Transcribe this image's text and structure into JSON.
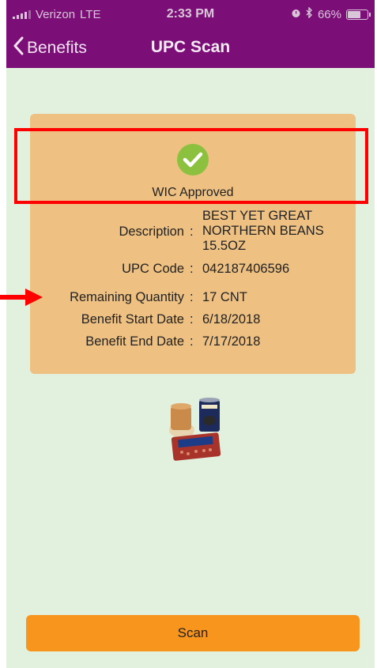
{
  "status_bar": {
    "carrier": "Verizon",
    "network": "LTE",
    "time": "2:33 PM",
    "battery": "66%"
  },
  "nav": {
    "back_label": "Benefits",
    "title": "UPC Scan"
  },
  "result": {
    "status": "WIC Approved",
    "fields": [
      {
        "label": "Description",
        "value": "BEST YET GREAT NORTHERN BEANS 15.5OZ"
      },
      {
        "label": "UPC Code",
        "value": "042187406596"
      },
      {
        "label": "Remaining Quantity",
        "value": "17 CNT"
      },
      {
        "label": "Benefit Start Date",
        "value": "6/18/2018"
      },
      {
        "label": "Benefit End Date",
        "value": "7/17/2018"
      }
    ]
  },
  "scan_button": "Scan",
  "colors": {
    "header": "#7b0f77",
    "background": "#e2f0de",
    "card": "#eec082",
    "approved_icon": "#8cc13f",
    "button": "#f8951d",
    "annotation": "#ff0000"
  },
  "icons": {
    "back": "chevron-left-icon",
    "approved": "check-circle-icon",
    "product": "beans-product-image"
  }
}
